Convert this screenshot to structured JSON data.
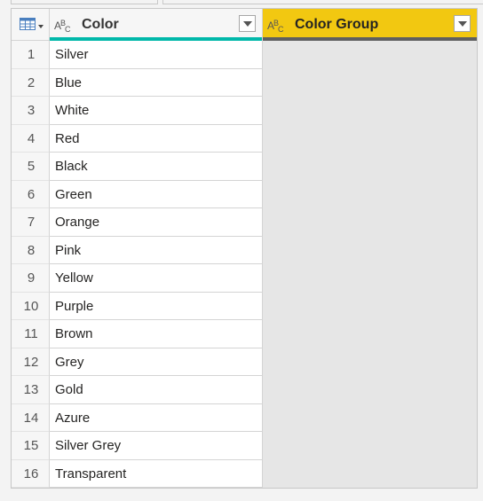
{
  "table": {
    "columns": [
      {
        "name": "Color",
        "type_icon": "text-type-icon",
        "accent": "#01b8aa"
      },
      {
        "name": "Color Group",
        "type_icon": "text-type-icon",
        "accent": "#f2c811"
      }
    ],
    "type_label": {
      "main": "A",
      "sup": "B",
      "sub": "C"
    },
    "rows": [
      {
        "index": "1",
        "color": "Silver",
        "group": ""
      },
      {
        "index": "2",
        "color": "Blue",
        "group": ""
      },
      {
        "index": "3",
        "color": "White",
        "group": ""
      },
      {
        "index": "4",
        "color": "Red",
        "group": ""
      },
      {
        "index": "5",
        "color": "Black",
        "group": ""
      },
      {
        "index": "6",
        "color": "Green",
        "group": ""
      },
      {
        "index": "7",
        "color": "Orange",
        "group": ""
      },
      {
        "index": "8",
        "color": "Pink",
        "group": ""
      },
      {
        "index": "9",
        "color": "Yellow",
        "group": ""
      },
      {
        "index": "10",
        "color": "Purple",
        "group": ""
      },
      {
        "index": "11",
        "color": "Brown",
        "group": ""
      },
      {
        "index": "12",
        "color": "Grey",
        "group": ""
      },
      {
        "index": "13",
        "color": "Gold",
        "group": ""
      },
      {
        "index": "14",
        "color": "Azure",
        "group": ""
      },
      {
        "index": "15",
        "color": "Silver Grey",
        "group": ""
      },
      {
        "index": "16",
        "color": "Transparent",
        "group": ""
      }
    ]
  }
}
